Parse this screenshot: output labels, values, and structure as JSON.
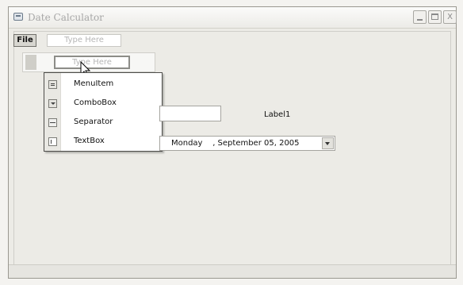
{
  "window": {
    "title": "Date Calculator",
    "minimize_label": "",
    "maximize_label": "",
    "close_label": "X"
  },
  "menubar": {
    "file_label": "File",
    "type_here_top": "Type Here",
    "type_here_sub": "Type Here"
  },
  "dropdown": {
    "items": [
      {
        "label": "MenuItem",
        "icon": "menu-item-icon"
      },
      {
        "label": "ComboBox",
        "icon": "combobox-icon"
      },
      {
        "label": "Separator",
        "icon": "separator-icon"
      },
      {
        "label": "TextBox",
        "icon": "textbox-icon"
      }
    ]
  },
  "form": {
    "textbox_value": "",
    "label1": "Label1",
    "date_value": "Monday    , September 05, 2005"
  },
  "statusbar": {
    "text": ""
  }
}
